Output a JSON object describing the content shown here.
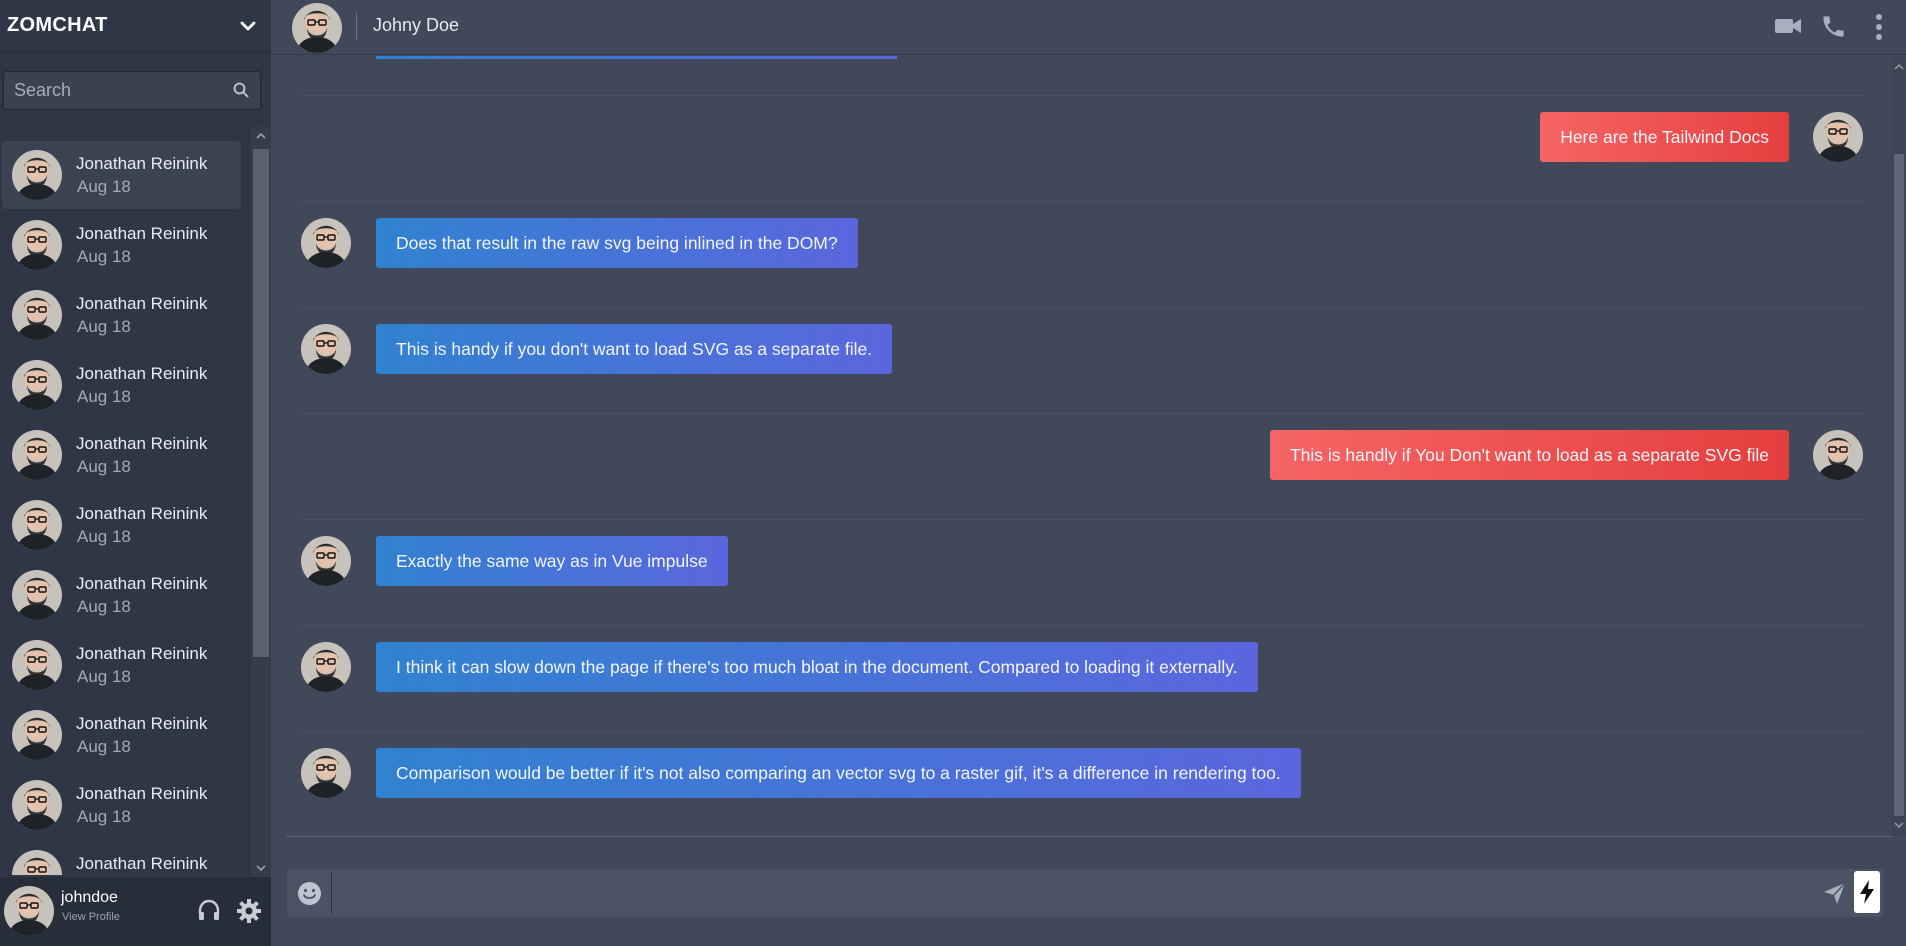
{
  "app": {
    "brand": "ZOMCHAT",
    "colors": {
      "sidebar_bg": "#2f3746",
      "main_bg": "#404859",
      "incoming_start": "#3182d0",
      "incoming_end": "#5b66de",
      "outgoing_start": "#f56565",
      "outgoing_end": "#e53e3e"
    }
  },
  "search": {
    "placeholder": "Search",
    "icon": "search-icon"
  },
  "sidebar": {
    "chats": [
      {
        "name": "Jonathan Reinink",
        "date": "Aug 18",
        "active": true
      },
      {
        "name": "Jonathan Reinink",
        "date": "Aug 18"
      },
      {
        "name": "Jonathan Reinink",
        "date": "Aug 18"
      },
      {
        "name": "Jonathan Reinink",
        "date": "Aug 18"
      },
      {
        "name": "Jonathan Reinink",
        "date": "Aug 18"
      },
      {
        "name": "Jonathan Reinink",
        "date": "Aug 18"
      },
      {
        "name": "Jonathan Reinink",
        "date": "Aug 18"
      },
      {
        "name": "Jonathan Reinink",
        "date": "Aug 18"
      },
      {
        "name": "Jonathan Reinink",
        "date": "Aug 18"
      },
      {
        "name": "Jonathan Reinink",
        "date": "Aug 18"
      },
      {
        "name": "Jonathan Reinink",
        "date": ""
      }
    ]
  },
  "user": {
    "username": "johndoe",
    "profile_link": "View Profile",
    "icons": [
      "headset-icon",
      "gear-icon"
    ]
  },
  "header": {
    "contact": "Johny Doe",
    "icons": [
      "video-camera-icon",
      "phone-icon",
      "more-vertical-icon"
    ]
  },
  "messages": [
    {
      "text": "Here are the Tailwind Docs",
      "direction": "out"
    },
    {
      "text": "Does that result in the raw svg being inlined in the DOM?",
      "direction": "in"
    },
    {
      "text": "This is handy if you don't want to load SVG as a separate file.",
      "direction": "in"
    },
    {
      "text": "This is handly if You Don't want to load as a separate SVG file",
      "direction": "out"
    },
    {
      "text": "Exactly the same way as in Vue impulse",
      "direction": "in"
    },
    {
      "text": "I think it can slow down the page if there's too much bloat in the document. Compared to loading it externally.",
      "direction": "in"
    },
    {
      "text": "Comparison would be better if it's not also comparing an vector svg to a raster gif, it's a difference in rendering too.",
      "direction": "in"
    }
  ],
  "composer": {
    "value": "",
    "icons": [
      "emoji-icon",
      "send-icon",
      "bolt-icon"
    ]
  }
}
